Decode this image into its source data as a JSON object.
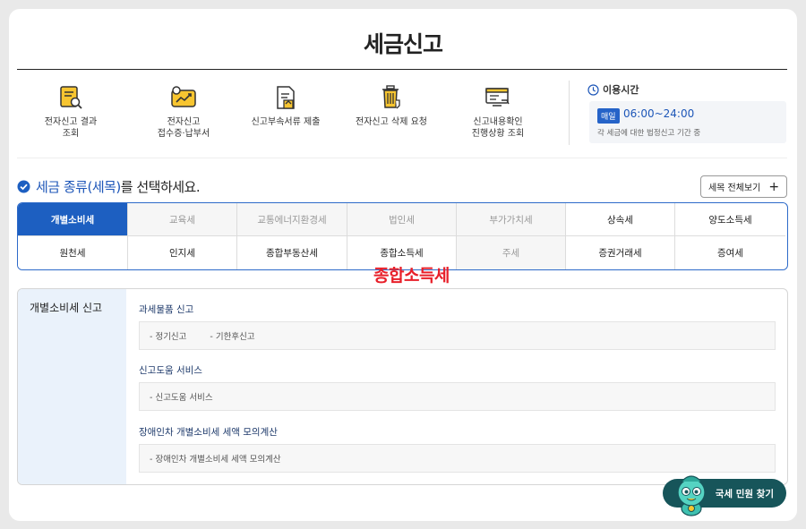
{
  "page": {
    "title": "세금신고"
  },
  "quick_links": [
    {
      "label": "전자신고 결과\n조회",
      "icon": "document-search-icon"
    },
    {
      "label": "전자신고\n접수증·납부서",
      "icon": "receipt-chart-icon"
    },
    {
      "label": "신고부속서류 제출",
      "icon": "document-upload-icon"
    },
    {
      "label": "전자신고 삭제 요청",
      "icon": "trash-icon"
    },
    {
      "label": "신고내용확인\n진행상황 조회",
      "icon": "monitor-check-icon"
    }
  ],
  "hours": {
    "title": "이용시간",
    "badge": "매일",
    "time": "06:00~24:00",
    "note": "각 세금에 대한 법정신고 기간 중"
  },
  "instruction": {
    "highlight": "세금 종류(세목)",
    "rest": "를 선택하세요."
  },
  "view_all": {
    "label": "세목 전체보기",
    "symbol": "+"
  },
  "tax_types": [
    {
      "label": "개별소비세",
      "state": "active"
    },
    {
      "label": "교육세",
      "state": "dim"
    },
    {
      "label": "교통에너지환경세",
      "state": "dim"
    },
    {
      "label": "법인세",
      "state": "dim"
    },
    {
      "label": "부가가치세",
      "state": "dim"
    },
    {
      "label": "상속세",
      "state": "normal"
    },
    {
      "label": "양도소득세",
      "state": "normal"
    },
    {
      "label": "원천세",
      "state": "normal"
    },
    {
      "label": "인지세",
      "state": "normal"
    },
    {
      "label": "종합부동산세",
      "state": "normal"
    },
    {
      "label": "종합소득세",
      "state": "normal"
    },
    {
      "label": "주세",
      "state": "dim"
    },
    {
      "label": "증권거래세",
      "state": "normal"
    },
    {
      "label": "증여세",
      "state": "normal"
    }
  ],
  "overlay_label": "종합소득세",
  "detail": {
    "side_title": "개별소비세 신고",
    "sections": [
      {
        "title": "과세물품 신고",
        "items": [
          "- 정기신고",
          "- 기한후신고"
        ]
      },
      {
        "title": "신고도움 서비스",
        "items": [
          "- 신고도움 서비스"
        ]
      },
      {
        "title": "장애인차 개별소비세 세액 모의계산",
        "items": [
          "- 장애인차 개별소비세 세액 모의계산"
        ]
      }
    ]
  },
  "fab": {
    "label": "국세 민원 찾기"
  },
  "colors": {
    "primary": "#1d5fc1",
    "highlight_red": "#e8202a",
    "fab_bg": "#17555a",
    "side_bg": "#eaf2fb"
  }
}
